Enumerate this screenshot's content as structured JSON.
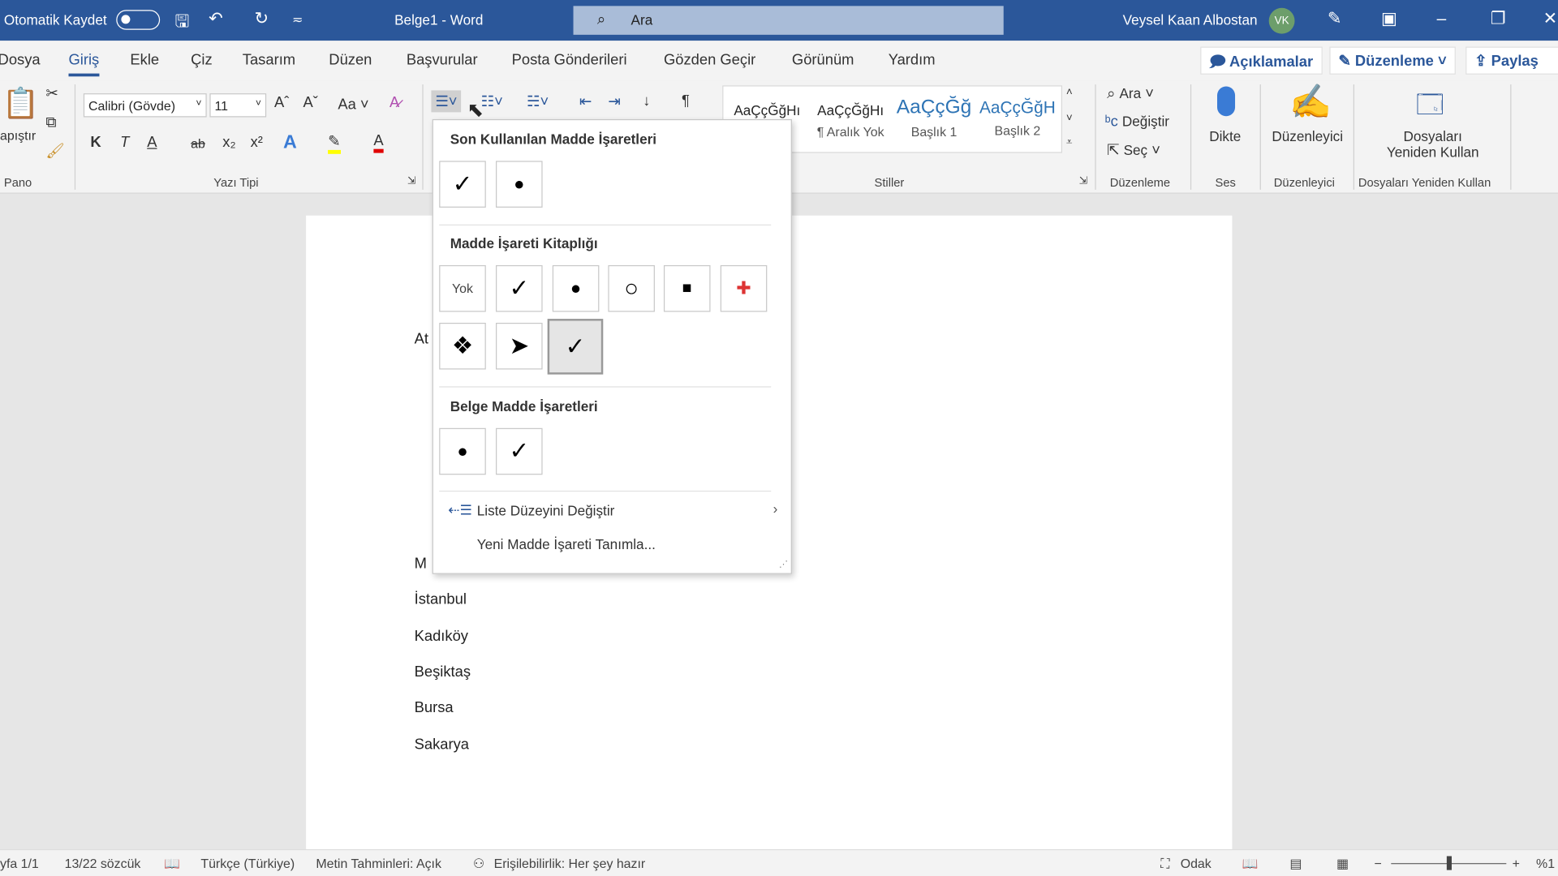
{
  "titlebar": {
    "autosave": "Otomatik Kaydet",
    "title": "Belge1  -  Word",
    "search_placeholder": "Ara",
    "user": "Veysel Kaan Albostan",
    "avatar": "VK"
  },
  "tabs": [
    "Dosya",
    "Giriş",
    "Ekle",
    "Çiz",
    "Tasarım",
    "Düzen",
    "Başvurular",
    "Posta Gönderileri",
    "Gözden Geçir",
    "Görünüm",
    "Yardım"
  ],
  "active_tab": "Giriş",
  "top_buttons": {
    "comments": "Açıklamalar",
    "editing": "Düzenleme",
    "share": "Paylaş"
  },
  "ribbon": {
    "paste": "apıştır",
    "font_name": "Calibri (Gövde)",
    "font_size": "11",
    "change_case": "Aa",
    "bold": "K",
    "italic": "T",
    "underline": "A",
    "styles": [
      {
        "preview": "AaÇçĞğHı",
        "name": ""
      },
      {
        "preview": "AaÇçĞğHı",
        "name": "¶ Aralık Yok"
      },
      {
        "preview": "AaÇçĞğ",
        "name": "Başlık 1"
      },
      {
        "preview": "AaÇçĞğH",
        "name": "Başlık 2"
      }
    ],
    "find": "Ara",
    "replace": "Değiştir",
    "select": "Seç",
    "dictate": "Dikte",
    "editor": "Düzenleyici",
    "reuse": "Dosyaları Yeniden Kullan",
    "groups": {
      "clipboard": "Pano",
      "font": "Yazı Tipi",
      "styles": "Stiller",
      "editing": "Düzenleme",
      "voice": "Ses",
      "editor": "Düzenleyici",
      "reuse": "Dosyaları Yeniden Kullan"
    }
  },
  "bullet_menu": {
    "recent_title": "Son Kullanılan Madde İşaretleri",
    "recent": [
      "✓",
      "●"
    ],
    "library_title": "Madde İşareti Kitaplığı",
    "library": [
      "Yok",
      "✓",
      "●",
      "○",
      "■",
      "✚",
      "❖",
      "➤",
      "✓"
    ],
    "library_selected_index": 8,
    "document_title": "Belge Madde İşaretleri",
    "document": [
      "●",
      "✓"
    ],
    "change_level": "Liste Düzeyini Değiştir",
    "define_new": "Yeni Madde İşareti Tanımla..."
  },
  "document": {
    "lines": [
      "At",
      "M",
      "İstanbul",
      "Kadıköy",
      "Beşiktaş",
      "Bursa",
      "Sakarya"
    ]
  },
  "status": {
    "page": "yfa 1/1",
    "words": "13/22 sözcük",
    "language": "Türkçe (Türkiye)",
    "predictions": "Metin Tahminleri: Açık",
    "accessibility": "Erişilebilirlik: Her şey hazır",
    "focus": "Odak",
    "zoom": "%1"
  },
  "colors": {
    "accent": "#2b579a",
    "highlight": "#ffff00",
    "font_color": "#e00000"
  }
}
